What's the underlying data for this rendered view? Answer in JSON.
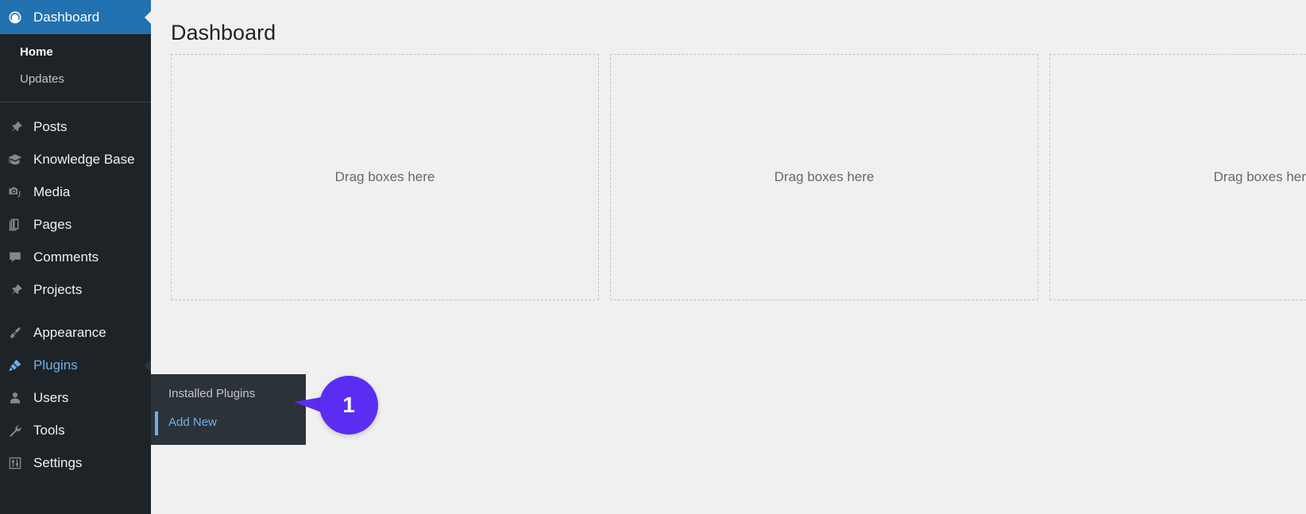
{
  "sidebar": {
    "current_item": "Dashboard",
    "dashboard": {
      "label": "Dashboard",
      "icon": "dashboard-gauge-icon",
      "submenu": [
        {
          "label": "Home",
          "active": true
        },
        {
          "label": "Updates",
          "active": false
        }
      ]
    },
    "groups": [
      {
        "items": [
          {
            "label": "Posts",
            "icon": "pin-icon"
          },
          {
            "label": "Knowledge Base",
            "icon": "graduation-cap-icon"
          },
          {
            "label": "Media",
            "icon": "media-camera-icon"
          },
          {
            "label": "Pages",
            "icon": "pages-icon"
          },
          {
            "label": "Comments",
            "icon": "comment-bubble-icon"
          },
          {
            "label": "Projects",
            "icon": "pin-icon"
          }
        ]
      },
      {
        "items": [
          {
            "label": "Appearance",
            "icon": "paintbrush-icon"
          },
          {
            "label": "Plugins",
            "icon": "plug-icon",
            "state": "open"
          },
          {
            "label": "Users",
            "icon": "user-icon"
          },
          {
            "label": "Tools",
            "icon": "wrench-icon"
          },
          {
            "label": "Settings",
            "icon": "sliders-icon"
          }
        ]
      }
    ]
  },
  "flyout": {
    "parent": "Plugins",
    "items": [
      {
        "label": "Installed Plugins",
        "current": false
      },
      {
        "label": "Add New",
        "current": true
      }
    ]
  },
  "main": {
    "title": "Dashboard",
    "drop_zones": [
      {
        "label": "Drag boxes here"
      },
      {
        "label": "Drag boxes here"
      },
      {
        "label": "Drag boxes here"
      }
    ]
  },
  "callout": {
    "number": "1"
  },
  "colors": {
    "sidebar_bg": "#1d2327",
    "submenu_bg": "#2c3338",
    "current_blue": "#2271b1",
    "link_blue": "#72aee6",
    "content_bg": "#f0f0f1",
    "dashed_border": "#c3c4c7",
    "callout_purple": "#5c2df2",
    "title_text": "#1d2327",
    "muted_text": "#646970"
  }
}
